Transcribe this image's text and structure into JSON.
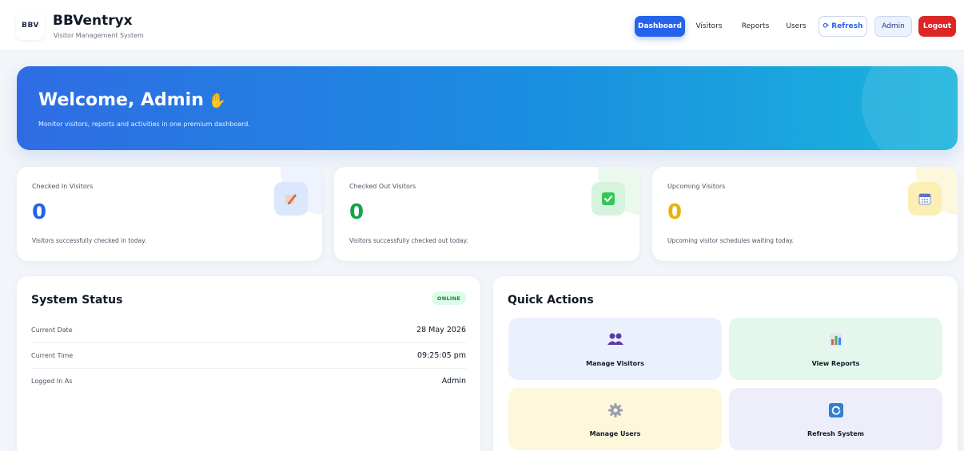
{
  "header": {
    "logo_text": "BBV",
    "brand": "BBVentryx",
    "subtitle": "Visitor Management System",
    "nav": {
      "dashboard": "Dashboard",
      "visitors": "Visitors",
      "reports": "Reports",
      "users": "Users",
      "refresh": "Refresh",
      "admin": "Admin",
      "logout": "Logout"
    }
  },
  "hero": {
    "title": "Welcome, Admin",
    "subtitle": "Monitor visitors, reports and activities in one premium dashboard."
  },
  "stats": [
    {
      "label": "Checked In Visitors",
      "value": "0",
      "desc": "Visitors successfully checked in today.",
      "icon": "edit-icon",
      "color": "#2563eb"
    },
    {
      "label": "Checked Out Visitors",
      "value": "0",
      "desc": "Visitors successfully checked out today.",
      "icon": "check-box-icon",
      "color": "#16a34a"
    },
    {
      "label": "Upcoming Visitors",
      "value": "0",
      "desc": "Upcoming visitor schedules waiting today.",
      "icon": "calendar-icon",
      "color": "#eab308"
    }
  ],
  "system_status": {
    "title": "System Status",
    "badge": "ONLINE",
    "rows": [
      {
        "key": "Current Date",
        "value": "28 May 2026"
      },
      {
        "key": "Current Time",
        "value": "09:25:05 pm"
      },
      {
        "key": "Logged In As",
        "value": "Admin"
      }
    ]
  },
  "quick_actions": {
    "title": "Quick Actions",
    "items": [
      {
        "label": "Manage Visitors",
        "icon": "users-icon"
      },
      {
        "label": "View Reports",
        "icon": "bar-chart-icon"
      },
      {
        "label": "Manage Users",
        "icon": "gear-icon"
      },
      {
        "label": "Refresh System",
        "icon": "refresh-icon"
      }
    ]
  },
  "colors": {
    "primary": "#2563eb",
    "danger": "#dc2626",
    "success": "#16a34a",
    "warning": "#eab308"
  }
}
